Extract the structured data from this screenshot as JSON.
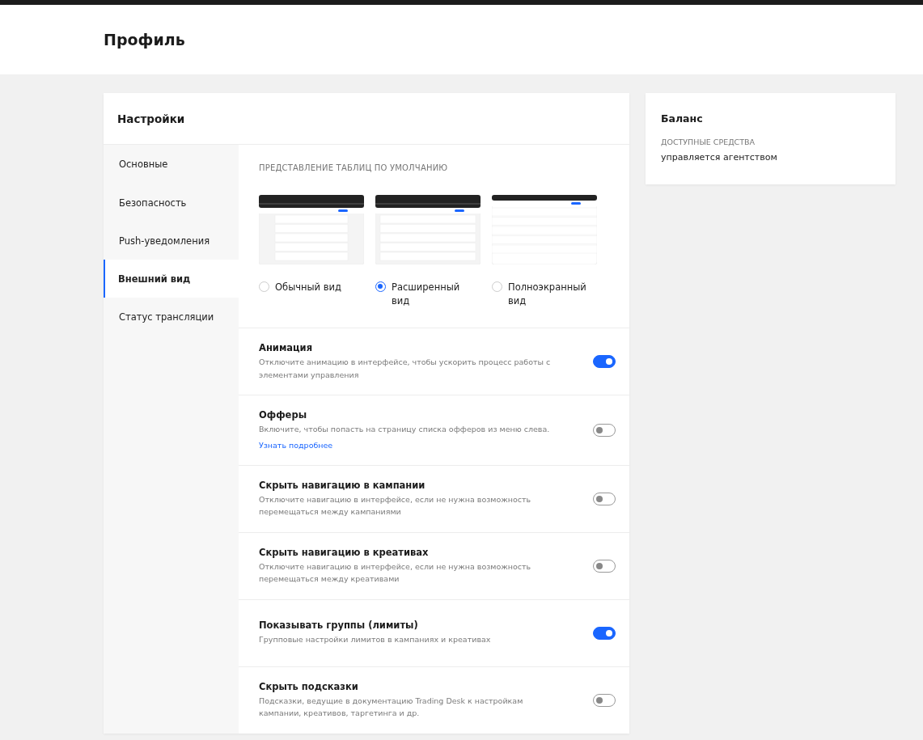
{
  "page": {
    "title": "Профиль"
  },
  "settings": {
    "title": "Настройки",
    "menu": [
      {
        "label": "Основные",
        "selected": false
      },
      {
        "label": "Безопасность",
        "selected": false
      },
      {
        "label": "Push-уведомления",
        "selected": false
      },
      {
        "label": "Внешний вид",
        "selected": true
      },
      {
        "label": "Статус трансляции",
        "selected": false
      }
    ],
    "table_view": {
      "heading": "ПРЕДСТАВЛЕНИЕ ТАБЛИЦ ПО УМОЛЧАНИЮ",
      "options": [
        {
          "kind": "normal",
          "label": "Обычный вид",
          "selected": false
        },
        {
          "kind": "extended",
          "label": "Расширенный вид",
          "selected": true
        },
        {
          "kind": "fullscreen",
          "label": "Полноэкранный вид",
          "selected": false
        }
      ]
    },
    "toggles": [
      {
        "title": "Анимация",
        "description": "Отключите анимацию в интерфейсе, чтобы ускорить процесс работы с элементами управления",
        "on": true
      },
      {
        "title": "Офферы",
        "description": "Включите, чтобы попасть на страницу списка офферов из меню слева.",
        "link": "Узнать подробнее",
        "on": false
      },
      {
        "title": "Скрыть навигацию в кампании",
        "description": "Отключите навигацию в интерфейсе, если не нужна возможность перемещаться между кампаниями",
        "on": false
      },
      {
        "title": "Скрыть навигацию в креативах",
        "description": "Отключите навигацию в интерфейсе, если не нужна возможность перемещаться между креативами",
        "on": false
      },
      {
        "title": "Показывать группы (лимиты)",
        "description": "Групповые настройки лимитов в кампаниях и креативах",
        "on": true
      },
      {
        "title": "Скрыть подсказки",
        "description": "Подсказки, ведущие в документацию Trading Desk к настройкам кампании, креативов, таргетинга и др.",
        "on": false
      }
    ]
  },
  "balance": {
    "title": "Баланс",
    "label": "ДОСТУПНЫЕ СРЕДСТВА",
    "value": "управляется агентством"
  }
}
